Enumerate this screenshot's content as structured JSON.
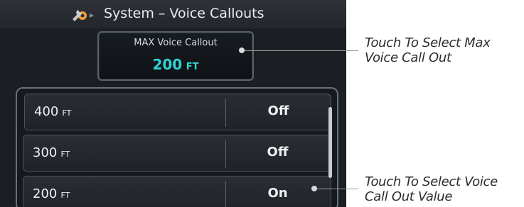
{
  "title_bar": {
    "title": "System – Voice Callouts",
    "icon": "wrench-gear-icon"
  },
  "max_callout": {
    "label": "MAX Voice Callout",
    "value": "200",
    "unit": "FT"
  },
  "callout_list": {
    "rows": [
      {
        "altitude": "400",
        "unit": "FT",
        "state": "Off"
      },
      {
        "altitude": "300",
        "unit": "FT",
        "state": "Off"
      },
      {
        "altitude": "200",
        "unit": "FT",
        "state": "On"
      }
    ]
  },
  "annotations": {
    "max_callout_line1": "Touch To Select Max",
    "max_callout_line2": "Voice Call Out",
    "callout_value_line1": "Touch To Select Voice",
    "callout_value_line2": "Call Out Value"
  },
  "colors": {
    "screen_background": "#1b1e22",
    "value_accent": "#2fd3cf",
    "text": "#eef0f2",
    "annotation_text": "#2b2b2b"
  }
}
